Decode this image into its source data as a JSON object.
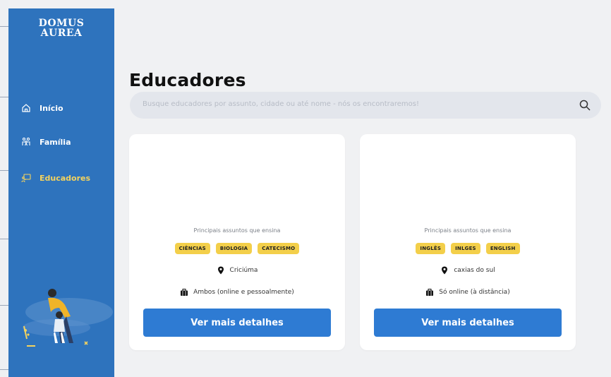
{
  "sidebar": {
    "logo_line1": "DOMUS",
    "logo_line2": "AUREA",
    "items": [
      {
        "label": "Início",
        "icon": "home-icon"
      },
      {
        "label": "Família",
        "icon": "family-icon"
      },
      {
        "label": "Educadores",
        "icon": "educator-board-icon",
        "active": true
      }
    ]
  },
  "main": {
    "title": "Educadores",
    "search": {
      "placeholder": "Busque educadores por assunto, cidade ou até nome - nós os encontraremos!"
    },
    "cards": [
      {
        "subjects_label": "Principais assuntos que ensina",
        "tags": [
          "CIÊNCIAS",
          "BIOLOGIA",
          "CATECISMO"
        ],
        "city": "Criciúma",
        "modality": "Ambos (online e pessoalmente)",
        "button": "Ver mais detalhes"
      },
      {
        "subjects_label": "Principais assuntos que ensina",
        "tags": [
          "INGLÊS",
          "INLGES",
          "ENGLISH"
        ],
        "city": "caxias do sul",
        "modality": "Só online (à distância)",
        "button": "Ver mais detalhes"
      }
    ]
  },
  "colors": {
    "sidebar": "#2e73bd",
    "active_nav": "#f4d35e",
    "tag": "#f3cf4a",
    "button": "#2e7bd3",
    "background": "#f0f1f3"
  }
}
